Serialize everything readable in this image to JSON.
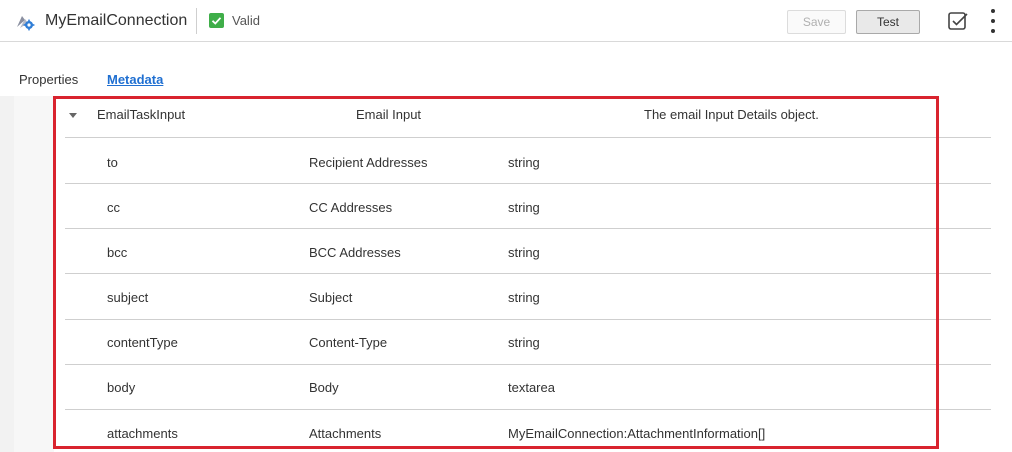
{
  "header": {
    "connection_name": "MyEmailConnection",
    "status": "Valid",
    "save_label": "Save",
    "test_label": "Test"
  },
  "tabs": [
    {
      "label": "Properties",
      "active": false
    },
    {
      "label": "Metadata",
      "active": true
    }
  ],
  "object": {
    "name": "EmailTaskInput",
    "label": "Email Input",
    "description": "The email Input Details object."
  },
  "fields": [
    {
      "name": "to",
      "label": "Recipient Addresses",
      "type": "string"
    },
    {
      "name": "cc",
      "label": "CC Addresses",
      "type": "string"
    },
    {
      "name": "bcc",
      "label": "BCC Addresses",
      "type": "string"
    },
    {
      "name": "subject",
      "label": "Subject",
      "type": "string"
    },
    {
      "name": "contentType",
      "label": "Content-Type",
      "type": "string"
    },
    {
      "name": "body",
      "label": "Body",
      "type": "textarea"
    },
    {
      "name": "attachments",
      "label": "Attachments",
      "type": "MyEmailConnection:AttachmentInformation[]"
    }
  ],
  "colors": {
    "valid": "#3fae49",
    "link": "#1f6fd1",
    "highlight": "#d9232e"
  },
  "icons": [
    "connection-gear-icon",
    "check-icon",
    "check-outline-icon",
    "kebab-menu-icon",
    "caret-down-icon"
  ]
}
